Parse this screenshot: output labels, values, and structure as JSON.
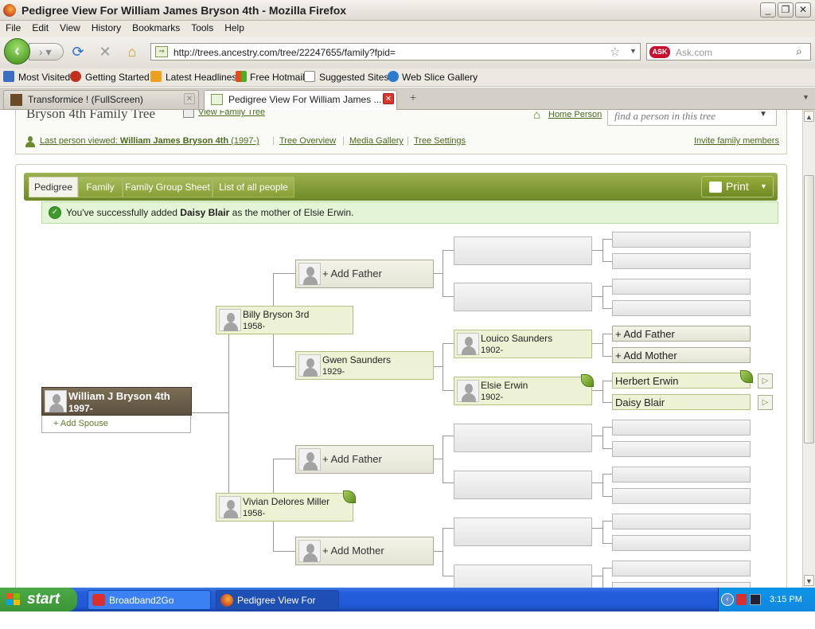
{
  "window": {
    "title": "Pedigree View For William James Bryson 4th - Mozilla Firefox"
  },
  "menu": [
    "File",
    "Edit",
    "View",
    "History",
    "Bookmarks",
    "Tools",
    "Help"
  ],
  "nav": {
    "url": "http://trees.ancestry.com/tree/22247655/family?fpid=",
    "search_placeholder": "Ask.com",
    "search_logo": "ASK"
  },
  "bookmarks": [
    "Most Visited",
    "Getting Started",
    "Latest Headlines",
    "Free Hotmail",
    "Suggested Sites",
    "Web Slice Gallery"
  ],
  "tabs": [
    {
      "label": "Transformice ! (FullScreen)"
    },
    {
      "label": "Pedigree View For William James ..."
    }
  ],
  "tree": {
    "title": "Bryson 4th Family Tree",
    "view_link": "View Family Tree",
    "home_person": "Home Person",
    "find_placeholder": "find a person in this tree",
    "last_viewed_label": "Last person viewed:",
    "last_viewed_name": "William James Bryson 4th",
    "last_viewed_years": "(1997-)",
    "links": [
      "Tree Overview",
      "Media Gallery",
      "Tree Settings"
    ],
    "invite": "Invite family members",
    "view_tabs": [
      "Pedigree",
      "Family",
      "Family Group Sheet",
      "List of all people"
    ],
    "print": "Print",
    "success": {
      "pre": "You've successfully added ",
      "name": "Daisy Blair",
      "post": " as the mother of Elsie Erwin."
    },
    "root": {
      "name": "William J Bryson 4th",
      "years": "1997-",
      "add_spouse": "+ Add Spouse"
    },
    "people": {
      "billy": {
        "name": "Billy Bryson 3rd",
        "years": "1958-"
      },
      "vivian": {
        "name": "Vivian Delores Miller",
        "years": "1958-"
      },
      "gwen": {
        "name": "Gwen Saunders",
        "years": "1929-"
      },
      "louico": {
        "name": "Louico Saunders",
        "years": "1902-"
      },
      "elsie": {
        "name": "Elsie Erwin",
        "years": "1902-"
      },
      "herbert": {
        "name": "Herbert Erwin"
      },
      "daisy": {
        "name": "Daisy Blair"
      }
    },
    "add_father": "+ Add Father",
    "add_mother": "+ Add Mother"
  },
  "taskbar": {
    "start": "start",
    "tasks": [
      "Broadband2Go",
      "Pedigree View For Wil..."
    ],
    "clock": "3:15 PM"
  }
}
